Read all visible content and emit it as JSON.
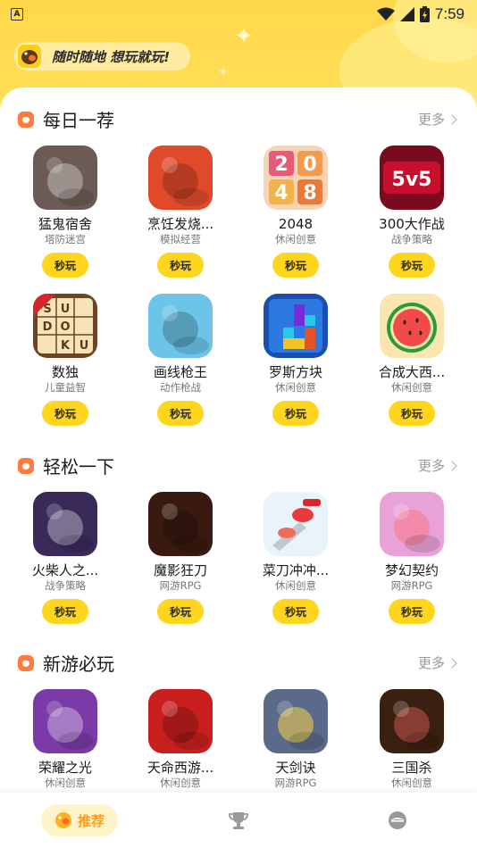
{
  "status_bar": {
    "time": "7:59",
    "app_icon_letter": "A"
  },
  "slogan": "随时随地 想玩就玩!",
  "play_label": "秒玩",
  "sections": [
    {
      "title": "每日一荐",
      "more": "更多",
      "games": [
        {
          "name": "猛鬼宿舍",
          "category": "塔防迷宫",
          "icon": "ghost-dorm-icon",
          "color": "#6b5a55"
        },
        {
          "name": "烹饪发烧...",
          "category": "模拟经营",
          "icon": "cooking-icon",
          "color": "#e04a2b"
        },
        {
          "name": "2048",
          "category": "休闲创意",
          "icon": "2048-icon",
          "color": "#f2c0a0"
        },
        {
          "name": "300大作战",
          "category": "战争策略",
          "icon": "5v5-icon",
          "color": "#c8102e"
        },
        {
          "name": "数独",
          "category": "儿童益智",
          "icon": "sudoku-icon",
          "color": "#5a3a1e"
        },
        {
          "name": "画线枪王",
          "category": "动作枪战",
          "icon": "gun-king-icon",
          "color": "#6cc4e8"
        },
        {
          "name": "罗斯方块",
          "category": "休闲创意",
          "icon": "tetris-icon",
          "color": "#1f6fd1"
        },
        {
          "name": "合成大西...",
          "category": "休闲创意",
          "icon": "watermelon-icon",
          "color": "#fbe3a8"
        }
      ]
    },
    {
      "title": "轻松一下",
      "more": "更多",
      "games": [
        {
          "name": "火柴人之...",
          "category": "战争策略",
          "icon": "stickman-icon",
          "color": "#3a2a5a"
        },
        {
          "name": "魔影狂刀",
          "category": "网游RPG",
          "icon": "shadow-blade-icon",
          "color": "#3a1a10"
        },
        {
          "name": "菜刀冲冲...",
          "category": "休闲创意",
          "icon": "knife-icon",
          "color": "#f1f1f1"
        },
        {
          "name": "梦幻契约",
          "category": "网游RPG",
          "icon": "dream-contract-icon",
          "color": "#e9a2d8"
        }
      ]
    },
    {
      "title": "新游必玩",
      "more": "更多",
      "games": [
        {
          "name": "荣耀之光",
          "category": "休闲创意",
          "icon": "glory-light-icon",
          "color": "#7a3aa8"
        },
        {
          "name": "天命西游...",
          "category": "休闲创意",
          "icon": "journey-west-icon",
          "color": "#c81e1e"
        },
        {
          "name": "天剑诀",
          "category": "网游RPG",
          "icon": "sky-sword-icon",
          "color": "#5a6a8a"
        },
        {
          "name": "三国杀",
          "category": "休闲创意",
          "icon": "three-kingdoms-icon",
          "color": "#3a2010"
        }
      ]
    }
  ],
  "tabs": [
    {
      "label": "推荐",
      "icon": "home-face-icon",
      "active": true
    },
    {
      "label": "",
      "icon": "trophy-icon",
      "active": false
    },
    {
      "label": "",
      "icon": "profile-icon",
      "active": false
    }
  ]
}
